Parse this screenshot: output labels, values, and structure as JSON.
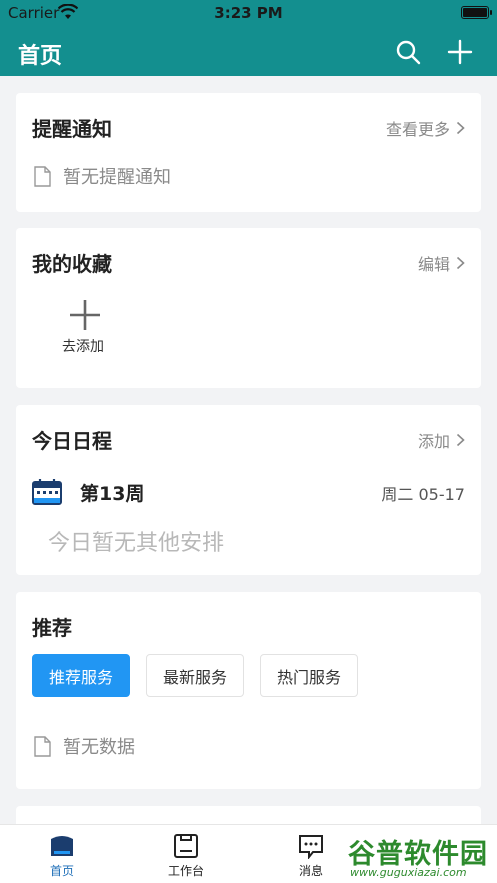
{
  "status_bar": {
    "carrier": "Carrier",
    "time": "3:23 PM"
  },
  "navbar": {
    "title": "首页",
    "icons": [
      "search-icon",
      "plus-icon"
    ]
  },
  "reminders": {
    "title": "提醒通知",
    "action": "查看更多",
    "empty_text": "暂无提醒通知"
  },
  "favorites": {
    "title": "我的收藏",
    "action": "编辑",
    "add_label": "去添加"
  },
  "schedule": {
    "title": "今日日程",
    "action": "添加",
    "week": "第13周",
    "date": "周二 05-17",
    "empty_text": "今日暂无其他安排"
  },
  "recommend": {
    "title": "推荐",
    "tabs": [
      {
        "label": "推荐服务",
        "active": true
      },
      {
        "label": "最新服务",
        "active": false
      },
      {
        "label": "热门服务",
        "active": false
      }
    ],
    "empty_text": "暂无数据"
  },
  "tabbar": {
    "items": [
      {
        "label": "首页",
        "icon": "home-icon",
        "active": true
      },
      {
        "label": "工作台",
        "icon": "workbench-icon",
        "active": false
      },
      {
        "label": "消息",
        "icon": "message-icon",
        "active": false
      }
    ]
  },
  "watermark": {
    "text": "谷普软件园",
    "url": "www.guguxiazai.com"
  },
  "colors": {
    "brand": "#138f8f",
    "accent": "#2196f3",
    "background": "#f2f3f5"
  }
}
